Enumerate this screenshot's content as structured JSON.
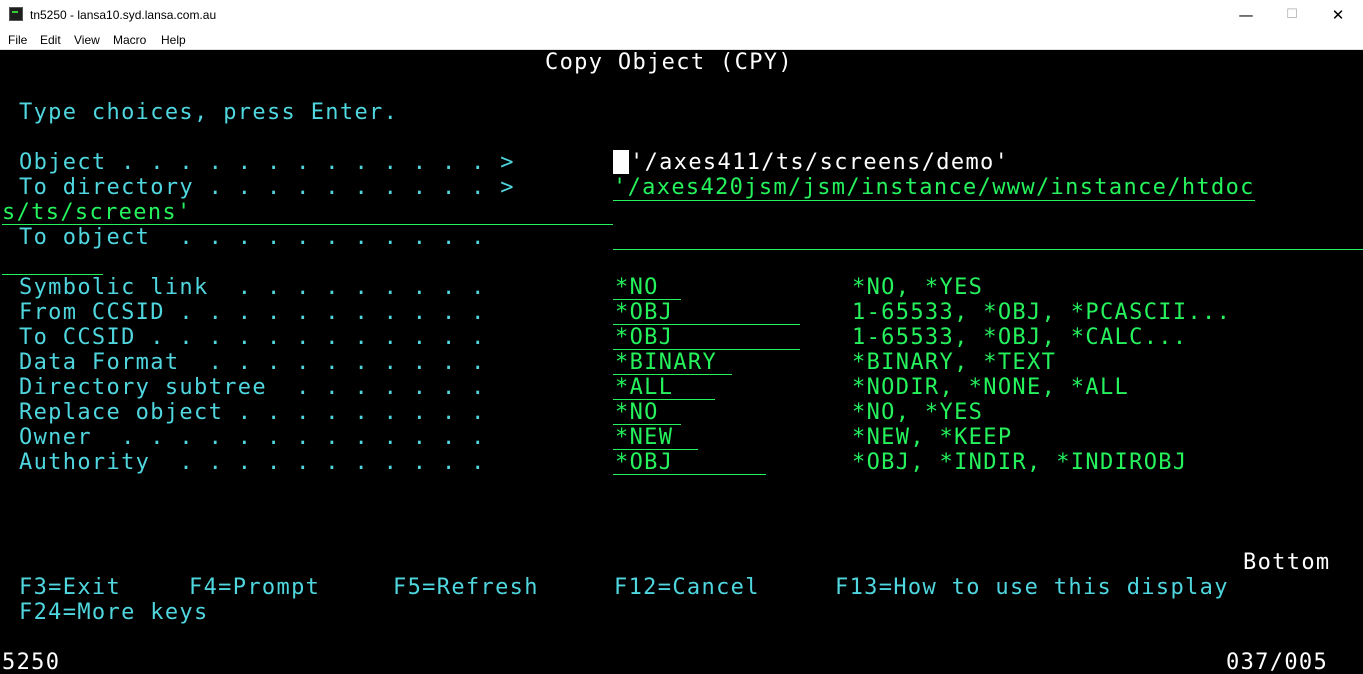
{
  "window": {
    "title": "tn5250 - lansa10.syd.lansa.com.au",
    "controls": {
      "minimize": "—",
      "maximize": "☐",
      "close": "✕"
    }
  },
  "menu": [
    "File",
    "Edit",
    "View",
    "Macro",
    "Help"
  ],
  "screen": {
    "title": "Copy Object (CPY)",
    "instructions": "Type choices, press Enter.",
    "params": [
      {
        "label": "Object . . . . . . . . . . . . . >",
        "value": "'/axes411/ts/screens/demo'"
      },
      {
        "label": "To directory . . . . . . . . . . >",
        "value": "'/axes420jsm/jsm/instance/www/instance/htdoc",
        "value_cont": "s/ts/screens'"
      },
      {
        "label": "To object  . . . . . . . . . . .",
        "value": ""
      },
      {
        "label": "Symbolic link  . . . . . . . . .",
        "value": "*NO",
        "choices": "*NO, *YES"
      },
      {
        "label": "From CCSID . . . . . . . . . . .",
        "value": "*OBJ",
        "choices": "1-65533, *OBJ, *PCASCII..."
      },
      {
        "label": "To CCSID . . . . . . . . . . . .",
        "value": "*OBJ",
        "choices": "1-65533, *OBJ, *CALC..."
      },
      {
        "label": "Data Format  . . . . . . . . . .",
        "value": "*BINARY",
        "choices": "*BINARY, *TEXT"
      },
      {
        "label": "Directory subtree  . . . . . . .",
        "value": "*ALL",
        "choices": "*NODIR, *NONE, *ALL"
      },
      {
        "label": "Replace object . . . . . . . . .",
        "value": "*NO",
        "choices": "*NO, *YES"
      },
      {
        "label": "Owner  . . . . . . . . . . . . .",
        "value": "*NEW",
        "choices": "*NEW, *KEEP"
      },
      {
        "label": "Authority  . . . . . . . . . . .",
        "value": "*OBJ",
        "choices": "*OBJ, *INDIR, *INDIROBJ"
      }
    ],
    "more_indicator": "Bottom",
    "fkeys_line1": [
      "F3=Exit",
      "F4=Prompt",
      "F5=Refresh",
      "F12=Cancel",
      "F13=How to use this display"
    ],
    "fkeys_line2": [
      "F24=More keys"
    ],
    "status_left": "5250",
    "status_right": "037/005"
  },
  "colors": {
    "background": "#000000",
    "text_green": "#25f25c",
    "text_cyan": "#4fd6de",
    "text_white": "#ffffff"
  }
}
